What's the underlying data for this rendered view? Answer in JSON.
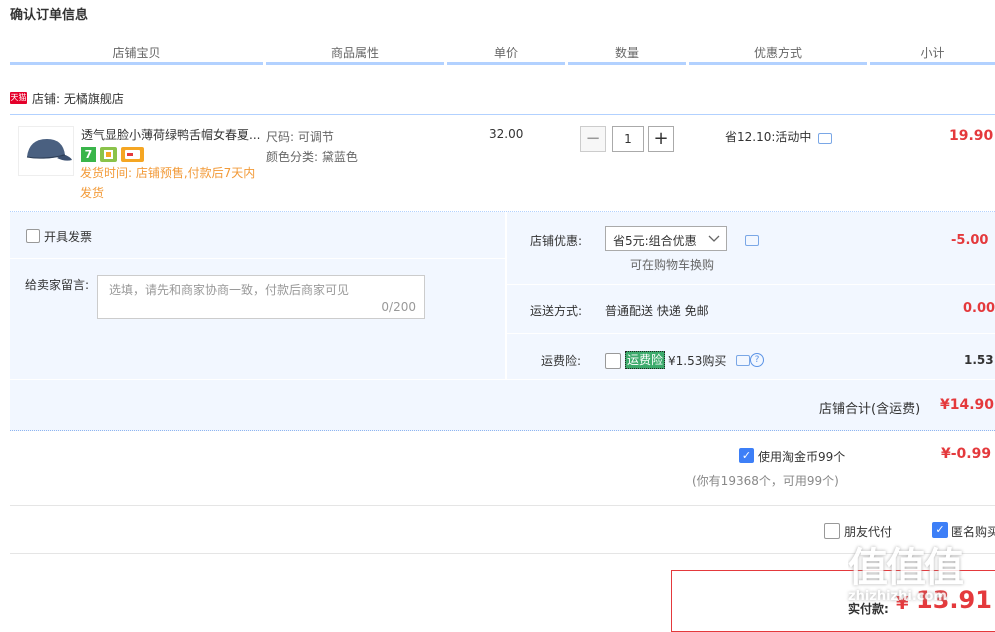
{
  "page": {
    "title": "确认订单信息"
  },
  "columns": [
    "店铺宝贝",
    "商品属性",
    "单价",
    "数量",
    "优惠方式",
    "小计"
  ],
  "shop": {
    "badge": "天猫",
    "name": "店铺: 无橘旗舰店"
  },
  "item": {
    "name": "透气显脸小薄荷绿鸭舌帽女春夏...",
    "badges": [
      "7",
      "",
      ""
    ],
    "ship_line1": "发货时间:   店铺预售,付款后7天内",
    "ship_line2": "发货",
    "attr_size": "尺码: 可调节",
    "attr_color": "颜色分类:   黛蓝色",
    "price": "32.00",
    "qty_minus": "−",
    "qty": "1",
    "qty_plus": "+",
    "promo": "省12.10:活动中",
    "subtotal": "19.90"
  },
  "invoice": {
    "label": "开具发票"
  },
  "message": {
    "label": "给卖家留言:",
    "placeholder": "选填，请先和商家协商一致，付款后商家可见",
    "counter": "0/200"
  },
  "shop_discount": {
    "label": "店铺优惠:",
    "selected": "省5元:组合优惠",
    "note": "可在购物车换购",
    "amount": "-5.00"
  },
  "shipping": {
    "label": "运送方式:",
    "value": "普通配送 快递 免邮",
    "amount": "0.00"
  },
  "insurance": {
    "label": "运费险:",
    "tag": "运费险",
    "value": "¥1.53购买",
    "amount": "1.53"
  },
  "shop_total": {
    "label": "店铺合计(含运费)",
    "amount": "¥14.90"
  },
  "coins": {
    "label": "使用淘金币99个",
    "note": "(你有19368个，可用99个)",
    "amount": "¥-0.99"
  },
  "options": {
    "friend_pay": "朋友代付",
    "anon": "匿名购买"
  },
  "pay": {
    "label": "实付款:",
    "currency": "¥",
    "amount": "13.91"
  },
  "watermark": {
    "text": "值值值",
    "sub": "zhizhizhi.com"
  },
  "colors": {
    "accent": "#e4393c",
    "blue_line": "#b2d1ff",
    "panel_bg": "#f2f7ff",
    "ship_text": "#f29a38"
  }
}
